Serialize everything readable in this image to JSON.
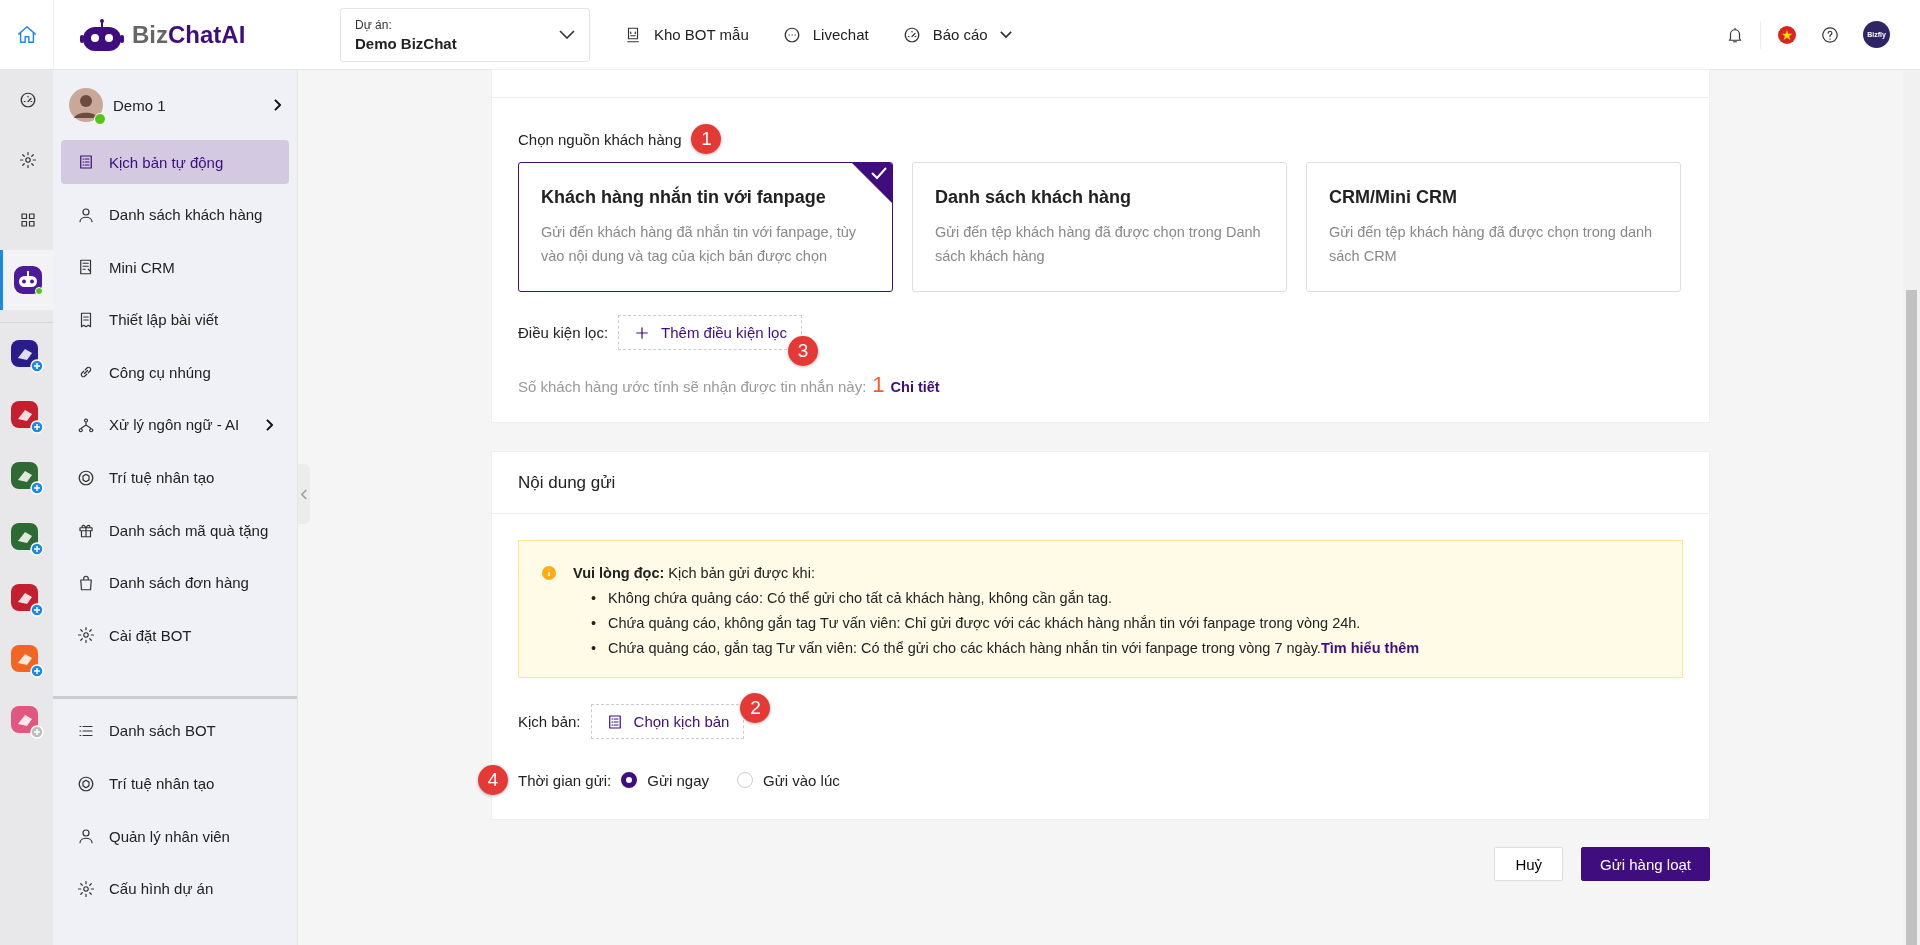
{
  "header": {
    "logo": {
      "part_a": "Biz",
      "part_b": "ChatAI"
    },
    "project": {
      "label": "Dự án:",
      "value": "Demo BizChat"
    },
    "nav": [
      {
        "label": "Kho BOT mẫu"
      },
      {
        "label": "Livechat"
      },
      {
        "label": "Báo cáo",
        "dropdown": true
      }
    ],
    "account": {
      "badge": "Bizfly"
    }
  },
  "rail": {
    "items": [
      {
        "selected": false
      },
      {
        "selected": false
      },
      {
        "selected": false
      },
      {
        "selected": true
      }
    ],
    "apps": [
      {
        "color": "#2a1c8a",
        "added": true
      },
      {
        "color": "#c41f2e",
        "added": true
      },
      {
        "color": "#2e6b34",
        "added": true
      },
      {
        "color": "#2e6b34",
        "added": true
      },
      {
        "color": "#c41f2e",
        "added": true
      },
      {
        "color": "#f26522",
        "added": true
      },
      {
        "color": "#e0577f",
        "added": false
      }
    ]
  },
  "sidebar": {
    "user": {
      "name": "Demo 1",
      "online": true
    },
    "items": [
      {
        "label": "Kịch bản tự động",
        "selected": true
      },
      {
        "label": "Danh sách khách hàng",
        "selected": false
      },
      {
        "label": "Mini CRM",
        "selected": false
      },
      {
        "label": "Thiết lập bài viết",
        "selected": false
      },
      {
        "label": "Công cụ nhúng",
        "selected": false
      },
      {
        "label": "Xử lý ngôn ngữ - AI",
        "selected": false,
        "expandable": true
      },
      {
        "label": "Trí tuệ nhân tạo",
        "selected": false
      },
      {
        "label": "Danh sách mã quà tặng",
        "selected": false
      },
      {
        "label": "Danh sách đơn hàng",
        "selected": false
      },
      {
        "label": "Cài đặt BOT",
        "selected": false
      }
    ],
    "bottom_items": [
      {
        "label": "Danh sách BOT",
        "selected": false
      },
      {
        "label": "Trí tuệ nhân tạo",
        "selected": false
      },
      {
        "label": "Quản lý nhân viên",
        "selected": false
      },
      {
        "label": "Cấu hình dự án",
        "selected": false
      }
    ]
  },
  "recipients": {
    "source_label": "Chọn nguồn khách hàng",
    "source_marker": "1",
    "sources": [
      {
        "title": "Khách hàng nhắn tin với fanpage",
        "description": "Gửi đến khách hàng đã nhắn tin với fanpage, tùy vào nội dung và tag của kịch bản được chọn",
        "selected": true
      },
      {
        "title": "Danh sách khách hàng",
        "description": "Gửi đến tệp khách hàng đã được chọn trong Danh sách khách hàng",
        "selected": false
      },
      {
        "title": "CRM/Mini CRM",
        "description": "Gửi đến tệp khách hàng đã được chọn trong danh sách CRM",
        "selected": false
      }
    ],
    "filter": {
      "label": "Điều kiện lọc:",
      "button": "Thêm điều kiện lọc",
      "marker": "3"
    },
    "estimate": {
      "text": "Số khách hàng ước tính sẽ nhận được tin nhắn này:",
      "count": "1",
      "link": "Chi tiết"
    }
  },
  "content": {
    "title": "Nội dung gửi",
    "notice": {
      "lead": "**Vui lòng đọc:** Kịch bản gửi được khi:",
      "bullets": [
        {
          "marker": "•",
          "text": "Không chứa quảng cáo: Có thể gửi cho tất cả khách hàng, không cần gắn tag."
        },
        {
          "marker": "•",
          "text": "Chứa quảng cáo, không gắn tag Tư vấn viên: Chỉ gửi được với các khách hàng nhắn tin với fanpage trong vòng 24h."
        },
        {
          "marker": "•",
          "text": "Chứa quảng cáo, gắn tag Tư vấn viên: Có thể gửi cho các khách hàng nhắn tin với fanpage trong vòng 7 ngày."
        }
      ],
      "link": "Tìm hiểu thêm"
    },
    "script": {
      "label": "Kịch bản:",
      "button": "Chọn kịch bản",
      "marker": "2"
    },
    "send_time": {
      "label": "Thời gian gửi:",
      "marker": "4",
      "options": [
        {
          "label": "Gửi ngay",
          "selected": true
        },
        {
          "label": "Gửi vào lúc",
          "selected": false
        }
      ]
    }
  },
  "buttons": {
    "cancel": "Huỷ",
    "submit": "Gửi hàng loạt"
  }
}
